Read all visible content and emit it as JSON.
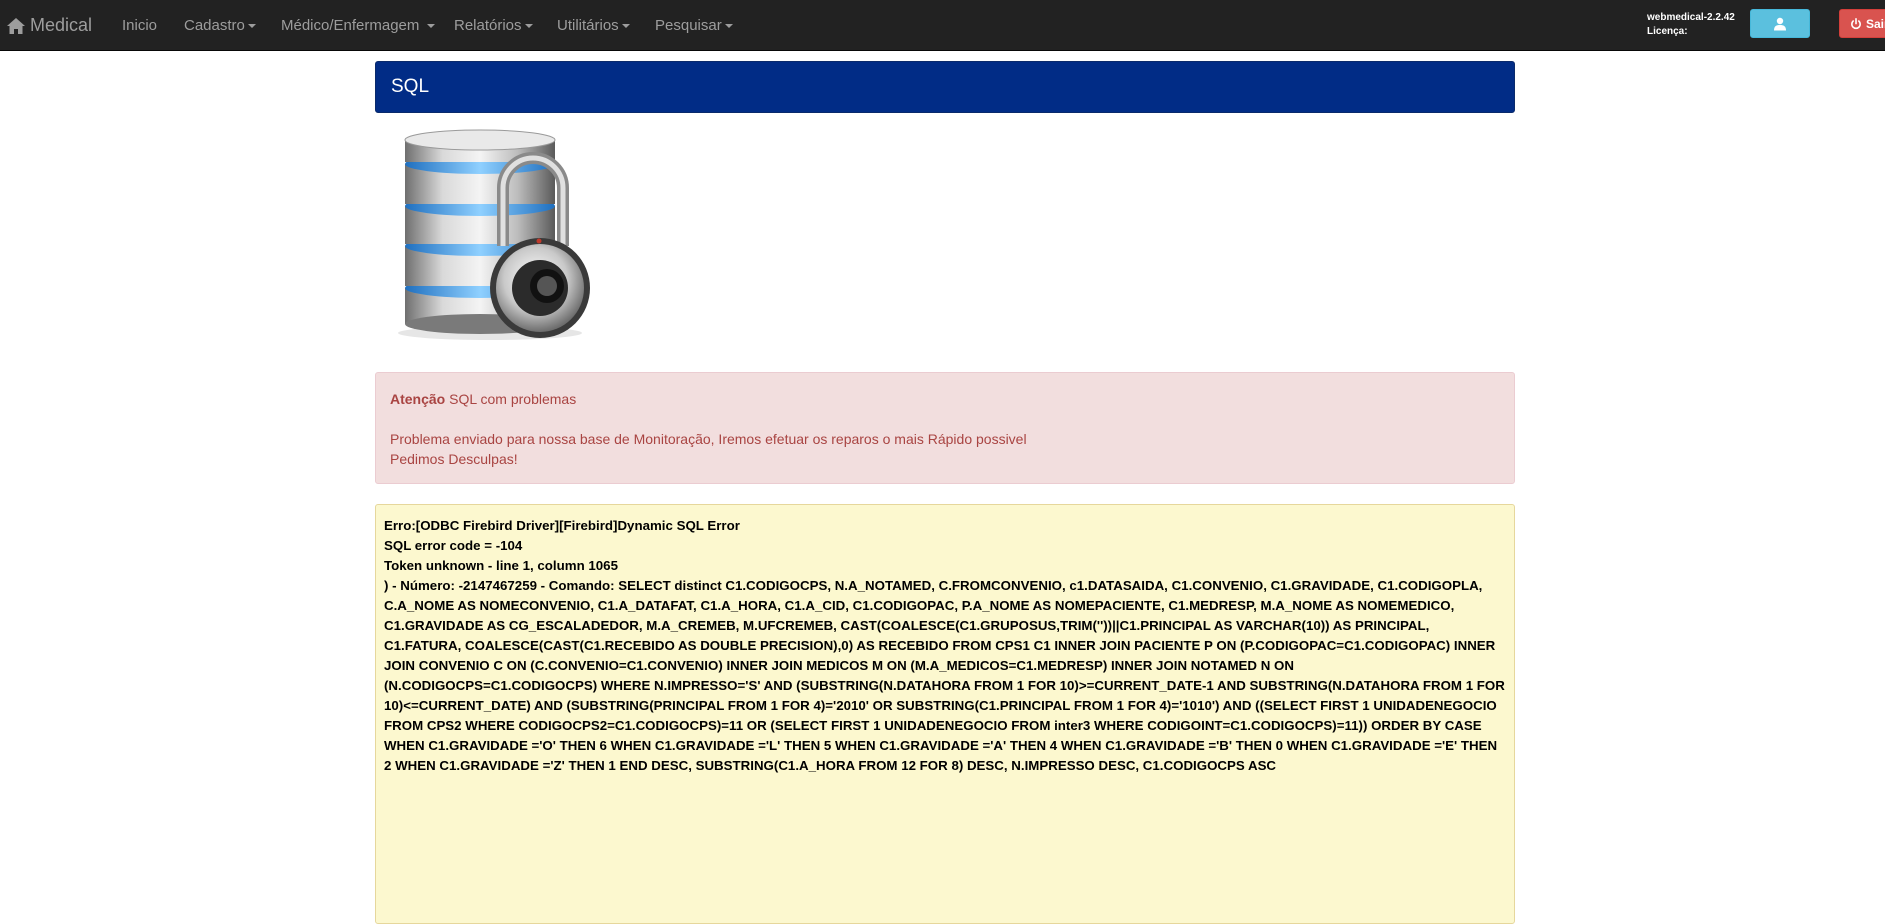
{
  "navbar": {
    "brand": "Medical",
    "items": [
      {
        "label": "Inicio",
        "dropdown": false
      },
      {
        "label": "Cadastro",
        "dropdown": true
      },
      {
        "label": "Médico/Enfermagem",
        "dropdown": true
      },
      {
        "label": "Relatórios",
        "dropdown": true
      },
      {
        "label": "Utilitários",
        "dropdown": true
      },
      {
        "label": "Pesquisar",
        "dropdown": true
      }
    ],
    "version": "webmedical-2.2.42",
    "license_label": "Licença:",
    "logout_label": "Sair"
  },
  "panel": {
    "title": "SQL"
  },
  "alert": {
    "strong": "Atenção",
    "message": " SQL com problemas",
    "line2": "Problema enviado para nossa base de Monitoração, Iremos efetuar os reparos o mais Rápido possivel",
    "line3": "Pedimos Desculpas!"
  },
  "error": {
    "line1": "Erro:[ODBC Firebird Driver][Firebird]Dynamic SQL Error",
    "line2": "SQL error code = -104",
    "line3": "Token unknown - line 1, column 1065",
    "detail": ") - Número: -2147467259 - Comando: SELECT distinct C1.CODIGOCPS, N.A_NOTAMED, C.FROMCONVENIO, c1.DATASAIDA, C1.CONVENIO, C1.GRAVIDADE, C1.CODIGOPLA, C.A_NOME AS NOMECONVENIO, C1.A_DATAFAT, C1.A_HORA, C1.A_CID, C1.CODIGOPAC, P.A_NOME AS NOMEPACIENTE, C1.MEDRESP, M.A_NOME AS NOMEMEDICO, C1.GRAVIDADE AS CG_ESCALADEDOR, M.A_CREMEB, M.UFCREMEB, CAST(COALESCE(C1.GRUPOSUS,TRIM(''))||C1.PRINCIPAL AS VARCHAR(10)) AS PRINCIPAL, C1.FATURA, COALESCE(CAST(C1.RECEBIDO AS DOUBLE PRECISION),0) AS RECEBIDO FROM CPS1 C1 INNER JOIN PACIENTE P ON (P.CODIGOPAC=C1.CODIGOPAC) INNER JOIN CONVENIO C ON (C.CONVENIO=C1.CONVENIO) INNER JOIN MEDICOS M ON (M.A_MEDICOS=C1.MEDRESP) INNER JOIN NOTAMED N ON (N.CODIGOCPS=C1.CODIGOCPS)  WHERE N.IMPRESSO='S'  AND (SUBSTRING(N.DATAHORA FROM 1 FOR 10)>=CURRENT_DATE-1 AND SUBSTRING(N.DATAHORA FROM 1 FOR 10)<=CURRENT_DATE) AND (SUBSTRING(PRINCIPAL FROM 1 FOR 4)='2010' OR SUBSTRING(C1.PRINCIPAL FROM 1 FOR 4)='1010')  AND ((SELECT FIRST 1 UNIDADENEGOCIO FROM CPS2 WHERE CODIGOCPS2=C1.CODIGOCPS)=11 OR (SELECT FIRST 1 UNIDADENEGOCIO FROM inter3 WHERE CODIGOINT=C1.CODIGOCPS)=11))  ORDER BY  CASE WHEN C1.GRAVIDADE ='O' THEN 6  WHEN C1.GRAVIDADE ='L' THEN 5 WHEN C1.GRAVIDADE ='A' THEN 4 WHEN C1.GRAVIDADE ='B' THEN 0 WHEN C1.GRAVIDADE ='E' THEN 2 WHEN  C1.GRAVIDADE ='Z' THEN 1  END  DESC,  SUBSTRING(C1.A_HORA FROM  12 FOR 8) DESC,  N.IMPRESSO DESC, C1.CODIGOCPS ASC"
  },
  "icons": {
    "brand": "home-icon",
    "user_button": "user-icon",
    "logout_button": "power-icon",
    "image": "database-lock-image"
  },
  "colors": {
    "navbar_bg": "#222222",
    "panel_heading_bg": "#012c86",
    "alert_bg": "#f2dede",
    "alert_text": "#a94442",
    "error_bg": "#fcf8cf",
    "user_button": "#5bc0de",
    "logout_button": "#d9534f"
  }
}
